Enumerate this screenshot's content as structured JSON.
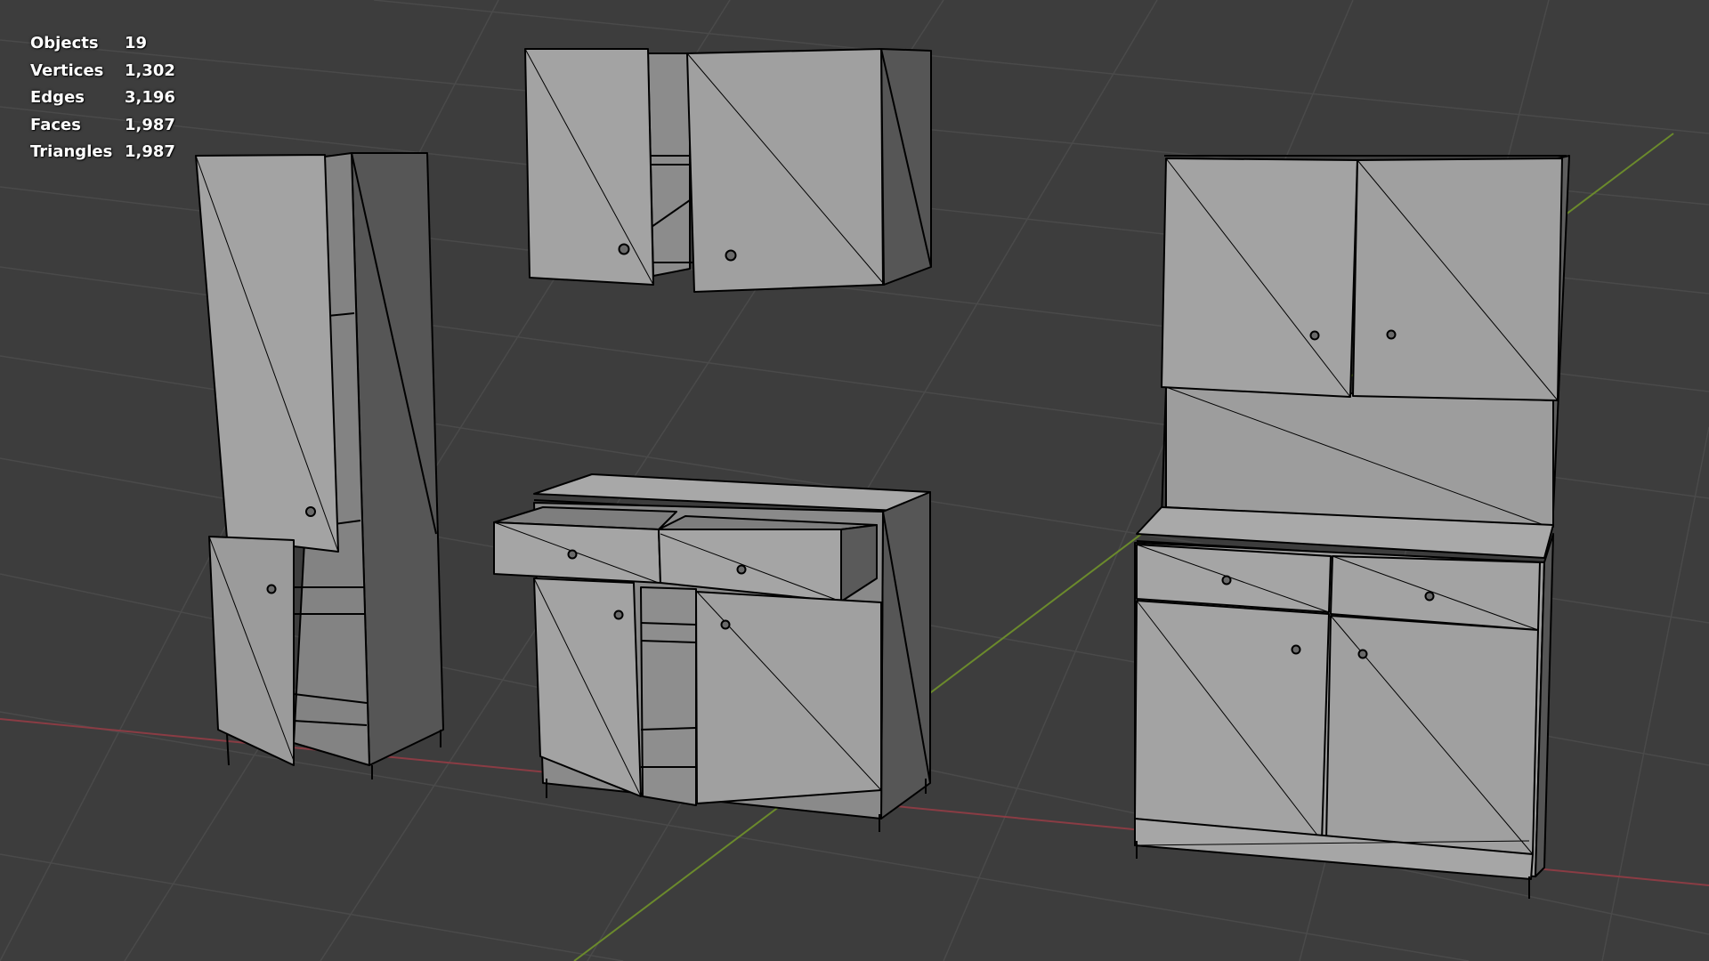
{
  "stats": [
    {
      "label": "Objects",
      "value": "19"
    },
    {
      "label": "Vertices",
      "value": "1,302"
    },
    {
      "label": "Edges",
      "value": "3,196"
    },
    {
      "label": "Faces",
      "value": "1,987"
    },
    {
      "label": "Triangles",
      "value": "1,987"
    }
  ],
  "colors": {
    "background": "#3d3d3d",
    "grid": "#4a4a4a",
    "x_axis": "#8a3c44",
    "y_axis": "#6b8a2c",
    "face_light": "#a3a3a3",
    "face_mid": "#8d8d8d",
    "face_dark": "#565656",
    "edge": "#000000"
  }
}
